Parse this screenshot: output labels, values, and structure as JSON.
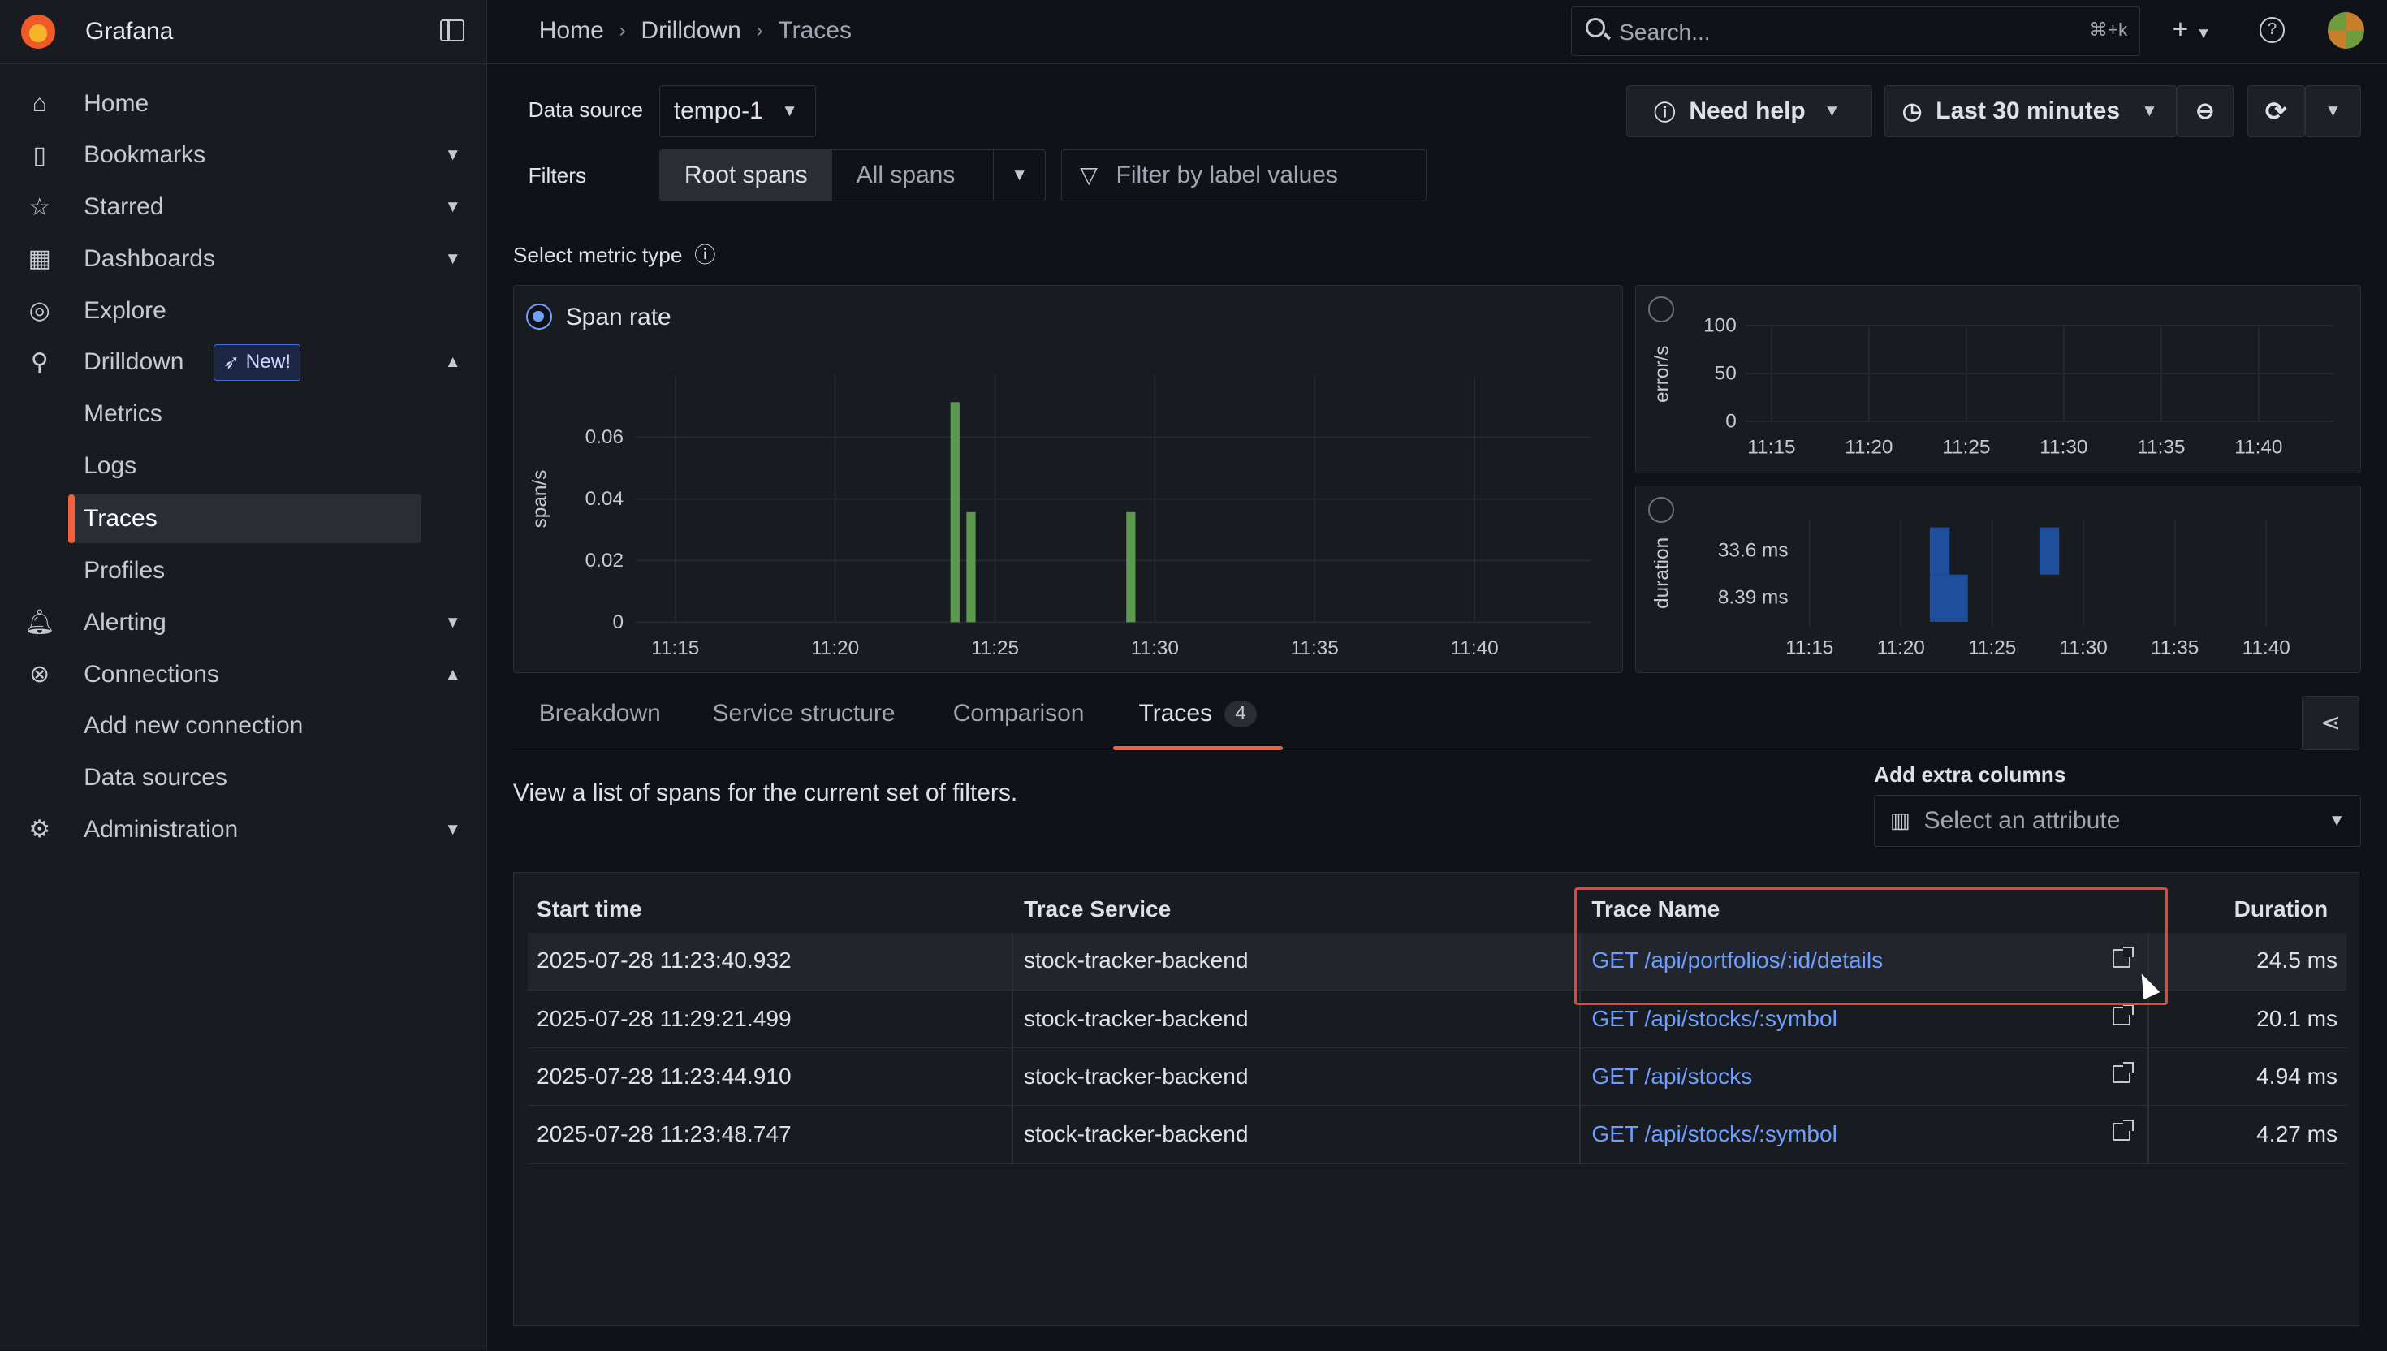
{
  "app": {
    "name": "Grafana"
  },
  "sidebar": {
    "items": [
      {
        "label": "Home"
      },
      {
        "label": "Bookmarks"
      },
      {
        "label": "Starred"
      },
      {
        "label": "Dashboards"
      },
      {
        "label": "Explore"
      },
      {
        "label": "Drilldown",
        "badge": "New!"
      },
      {
        "label": "Metrics"
      },
      {
        "label": "Logs"
      },
      {
        "label": "Traces"
      },
      {
        "label": "Profiles"
      },
      {
        "label": "Alerting"
      },
      {
        "label": "Connections"
      },
      {
        "label": "Add new connection"
      },
      {
        "label": "Data sources"
      },
      {
        "label": "Administration"
      }
    ]
  },
  "breadcrumb": [
    "Home",
    "Drilldown",
    "Traces"
  ],
  "search": {
    "placeholder": "Search...",
    "shortcut": "⌘+k"
  },
  "toolbar": {
    "help_label": "Need help",
    "time_range": "Last 30 minutes"
  },
  "datasource": {
    "label": "Data source",
    "value": "tempo-1"
  },
  "filters": {
    "label": "Filters",
    "options": [
      "Root spans",
      "All spans"
    ],
    "selected": "Root spans",
    "placeholder": "Filter by label values"
  },
  "metric_type_label": "Select metric type",
  "panels": {
    "span_rate": {
      "title": "Span rate",
      "ylabel": "span/s"
    },
    "errors": {
      "ylabel": "error/s"
    },
    "duration": {
      "ylabel": "duration"
    }
  },
  "chart_data": [
    {
      "type": "bar",
      "title": "Span rate",
      "ylabel": "span/s",
      "ylim": [
        0,
        0.08
      ],
      "yticks": [
        "0",
        "0.02",
        "0.04",
        "0.06"
      ],
      "xticks": [
        "11:15",
        "11:20",
        "11:25",
        "11:30",
        "11:35",
        "11:40"
      ],
      "bars": [
        {
          "x": "11:23:45",
          "value": 0.0714
        },
        {
          "x": "11:24:15",
          "value": 0.0357
        },
        {
          "x": "11:29:15",
          "value": 0.0357
        }
      ],
      "color": "#5a9a4c"
    },
    {
      "type": "line",
      "ylabel": "error/s",
      "yticks": [
        "0",
        "50",
        "100"
      ],
      "xticks": [
        "11:15",
        "11:20",
        "11:25",
        "11:30",
        "11:35",
        "11:40"
      ]
    },
    {
      "type": "heatmap",
      "ylabel": "duration",
      "yticks": [
        "8.39 ms",
        "33.6 ms"
      ],
      "xticks": [
        "11:15",
        "11:20",
        "11:25",
        "11:30",
        "11:35",
        "11:40"
      ],
      "cells": [
        {
          "x": "11:22",
          "y": "33.6 ms"
        },
        {
          "x": "11:22",
          "y": "8.39 ms"
        },
        {
          "x": "11:23",
          "y": "8.39 ms"
        },
        {
          "x": "11:28",
          "y": "33.6 ms"
        }
      ],
      "color": "#1f4e9c"
    }
  ],
  "tabs": [
    {
      "label": "Breakdown"
    },
    {
      "label": "Service structure"
    },
    {
      "label": "Comparison"
    },
    {
      "label": "Traces",
      "count": "4"
    }
  ],
  "traces": {
    "description": "View a list of spans for the current set of filters.",
    "extra_columns_label": "Add extra columns",
    "extra_columns_placeholder": "Select an attribute",
    "columns": [
      "Start time",
      "Trace Service",
      "Trace Name",
      "Duration"
    ],
    "rows": [
      {
        "start": "2025-07-28 11:23:40.932",
        "service": "stock-tracker-backend",
        "name": "GET /api/portfolios/:id/details",
        "duration": "24.5 ms"
      },
      {
        "start": "2025-07-28 11:29:21.499",
        "service": "stock-tracker-backend",
        "name": "GET /api/stocks/:symbol",
        "duration": "20.1 ms"
      },
      {
        "start": "2025-07-28 11:23:44.910",
        "service": "stock-tracker-backend",
        "name": "GET /api/stocks",
        "duration": "4.94 ms"
      },
      {
        "start": "2025-07-28 11:23:48.747",
        "service": "stock-tracker-backend",
        "name": "GET /api/stocks/:symbol",
        "duration": "4.27 ms"
      }
    ]
  }
}
